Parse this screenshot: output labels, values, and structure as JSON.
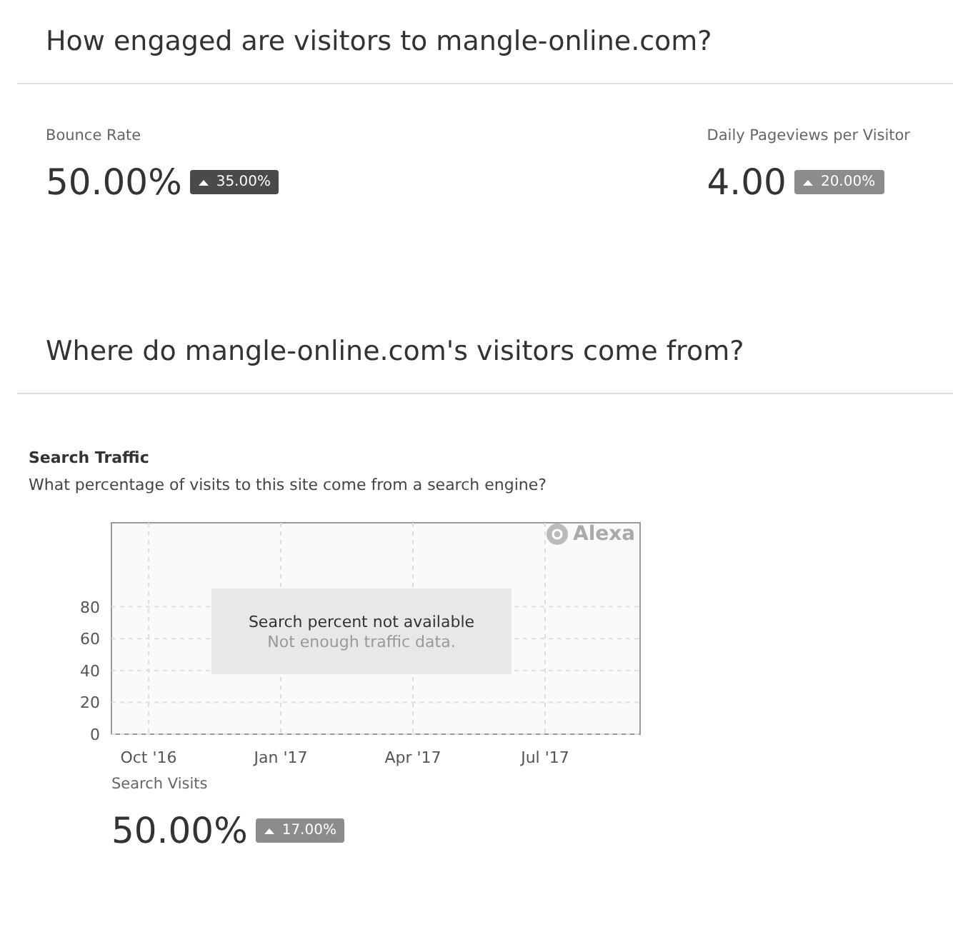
{
  "sections": [
    {
      "title": "How engaged are visitors to mangle-online.com?",
      "metrics": [
        {
          "label": "Bounce Rate",
          "value": "50.00%",
          "change": "35.00%",
          "color": "#4a4a4a"
        },
        {
          "label": "Daily Pageviews per Visitor",
          "value": "4.00",
          "change": "20.00%",
          "color": "#8c8c8c"
        }
      ]
    },
    {
      "title": "Where do mangle-online.com's visitors come from?",
      "search_traffic": {
        "heading": "Search Traffic",
        "question": "What percentage of visits to this site come from a search engine?",
        "chart": {
          "brand": "Alexa",
          "message": "Search percent not available",
          "submessage": "Not enough traffic data.",
          "yticks": [
            "80",
            "60",
            "40",
            "20",
            "0"
          ],
          "xlabels": [
            "Oct '16",
            "Jan '17",
            "Apr '17",
            "Jul '17"
          ]
        },
        "metric": {
          "label": "Search Visits",
          "value": "50.00%",
          "change": "17.00%",
          "color": "#8c8c8c"
        }
      }
    }
  ]
}
